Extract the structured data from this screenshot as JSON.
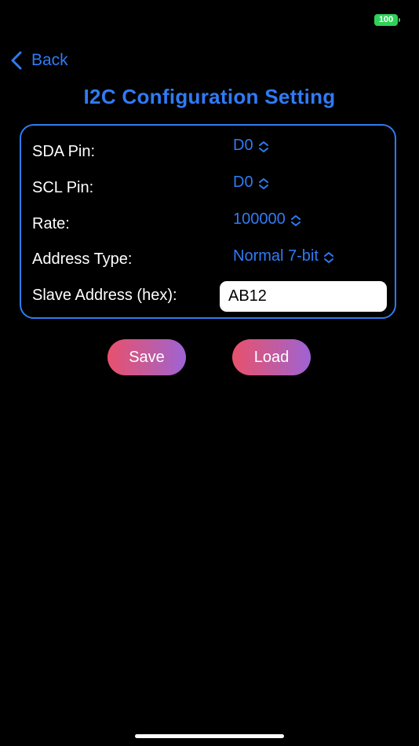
{
  "status_bar": {
    "battery_level": "100",
    "battery_color": "#30d158"
  },
  "nav": {
    "back_label": "Back",
    "back_icon": "chevron-left-icon"
  },
  "title": "I2C Configuration Setting",
  "config": {
    "sda_label": "SDA Pin:",
    "sda_value": "D0",
    "scl_label": "SCL Pin:",
    "scl_value": "D0",
    "rate_label": "Rate:",
    "rate_value": "100000",
    "address_type_label": "Address Type:",
    "address_type_value": "Normal 7-bit",
    "slave_address_label": "Slave Address (hex):",
    "slave_address_value": "AB12",
    "picker_icon": "chevron-up-down-icon"
  },
  "actions": {
    "save_label": "Save",
    "load_label": "Load"
  },
  "colors": {
    "accent": "#2f7bf5",
    "button_gradient_start": "#e8516d",
    "button_gradient_end": "#9e63d6",
    "background": "#000000"
  }
}
